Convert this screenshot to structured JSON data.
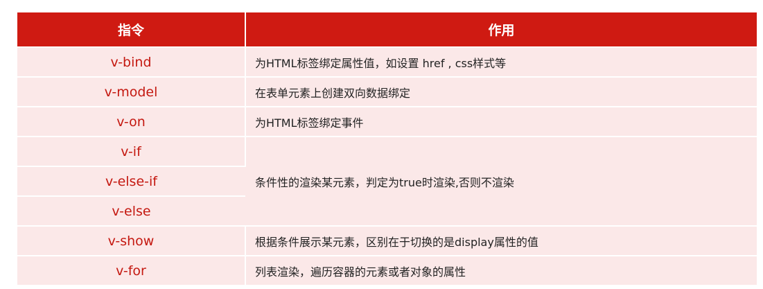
{
  "table": {
    "headers": [
      "指令",
      "作用"
    ],
    "rows": [
      {
        "directive": "v-bind",
        "description": "为HTML标签绑定属性值，如设置 href , css样式等"
      },
      {
        "directive": "v-model",
        "description": "在表单元素上创建双向数据绑定"
      },
      {
        "directive": "v-on",
        "description": "为HTML标签绑定事件"
      },
      {
        "directive": "v-if",
        "description": "条件性的渲染某元素，判定为true时渲染,否则不渲染"
      },
      {
        "directive": "v-else-if",
        "description": ""
      },
      {
        "directive": "v-else",
        "description": ""
      },
      {
        "directive": "v-show",
        "description": "根据条件展示某元素，区别在于切换的是display属性的值"
      },
      {
        "directive": "v-for",
        "description": "列表渲染，遍历容器的元素或者对象的属性"
      }
    ]
  },
  "colors": {
    "header_bg": "#cf1a12",
    "header_text": "#ffffff",
    "row_bg": "#fbe8e8",
    "directive_text": "#c41810",
    "description_text": "#222222"
  }
}
